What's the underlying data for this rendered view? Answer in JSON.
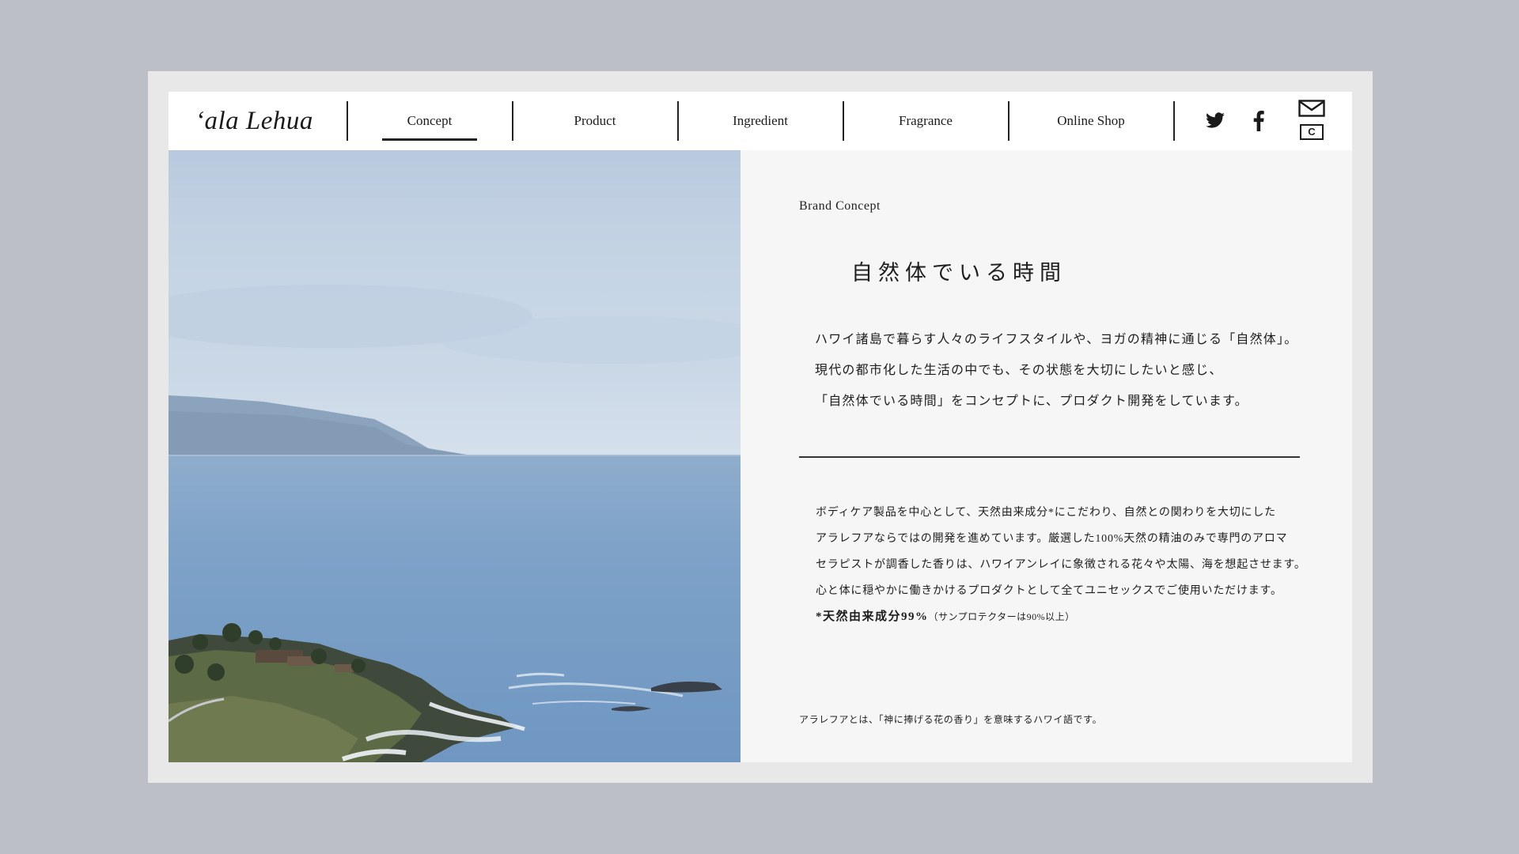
{
  "brand": {
    "logo": "ʻala Lehua"
  },
  "nav": {
    "items": [
      {
        "label": "Concept"
      },
      {
        "label": "Product"
      },
      {
        "label": "Ingredient"
      },
      {
        "label": "Fragrance"
      },
      {
        "label": "Online Shop"
      }
    ],
    "active": "Concept"
  },
  "social": {
    "twitter_icon": "twitter-icon",
    "facebook_icon": "facebook-icon",
    "mail_icon": "mail-icon",
    "copyright_icon": "copyright-c-icon",
    "copyright_letter": "C"
  },
  "hero": {
    "icon": "ocean-coastline-photo"
  },
  "concept": {
    "section_label": "Brand Concept",
    "headline": "自然体でいる時間",
    "intro_lines": [
      "ハワイ諸島で暮らす人々のライフスタイルや、ヨガの精神に通じる「自然体」。",
      "現代の都市化した生活の中でも、その状態を大切にしたいと感じ、",
      "「自然体でいる時間」をコンセプトに、プロダクト開発をしています。"
    ],
    "body_lines": [
      "ボディケア製品を中心として、天然由来成分*にこだわり、自然との関わりを大切にした",
      "アラレフアならではの開発を進めています。厳選した100%天然の精油のみで専門のアロマ",
      "セラピストが調香した香りは、ハワイアンレイに象徴される花々や太陽、海を想起させます。",
      "心と体に穏やかに働きかけるプロダクトとして全てユニセックスでご使用いただけます。"
    ],
    "footnote_main": "*天然由来成分99%",
    "footnote_small": "（サンプロテクターは90%以上）",
    "caption": "アラレフアとは、「神に捧げる花の香り」を意味するハワイ語です。"
  },
  "colors": {
    "background": "#bcbfc5",
    "frame": "#e8e8e8",
    "page": "#f6f6f6",
    "text": "#1e1e1e",
    "sky": "#c7d6e6",
    "ocean": "#6f98c2"
  }
}
